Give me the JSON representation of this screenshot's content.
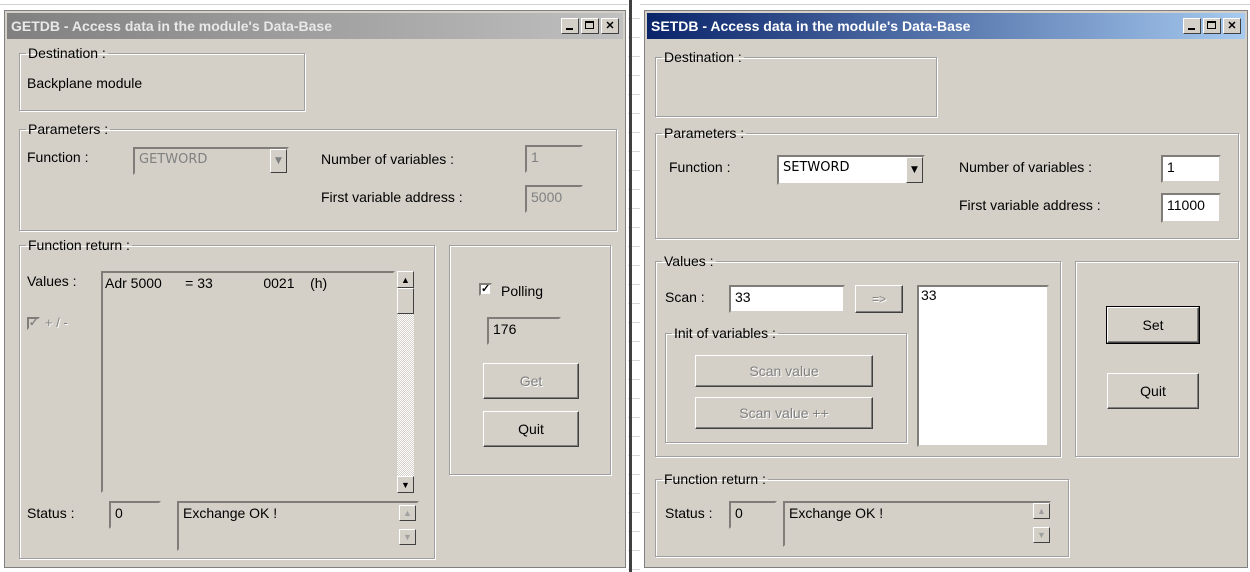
{
  "getdb": {
    "title": "GETDB - Access data in the module's Data-Base",
    "destination": {
      "legend": "Destination :",
      "value": "Backplane module"
    },
    "parameters": {
      "legend": "Parameters :",
      "function_label": "Function :",
      "function_value": "GETWORD",
      "numvars_label": "Number of variables :",
      "numvars_value": "1",
      "firstaddr_label": "First variable address :",
      "firstaddr_value": "5000"
    },
    "function_return": {
      "legend": "Function return :",
      "values_label": "Values :",
      "values_rows": [
        "Adr 5000      = 33             0021    (h)"
      ],
      "sign_label": "+ / -",
      "status_label": "Status :",
      "status_code": "0",
      "status_text": "Exchange OK !"
    },
    "polling": {
      "label": "Polling",
      "checked": true,
      "count": "176"
    },
    "get_button": "Get",
    "quit_button": "Quit"
  },
  "setdb": {
    "title": "SETDB - Access data in the module's Data-Base",
    "destination": {
      "legend": "Destination :",
      "value": ""
    },
    "parameters": {
      "legend": "Parameters :",
      "function_label": "Function :",
      "function_value": "SETWORD",
      "numvars_label": "Number of variables :",
      "numvars_value": "1",
      "firstaddr_label": "First variable address :",
      "firstaddr_value": "11000"
    },
    "values": {
      "legend": "Values :",
      "scan_label": "Scan :",
      "scan_value": "33",
      "arrow_button": "=>",
      "list_items": [
        "33"
      ],
      "init_legend": "Init of variables :",
      "scan_value_button": "Scan value",
      "scan_value_pp_button": "Scan value ++"
    },
    "set_button": "Set",
    "quit_button": "Quit",
    "function_return": {
      "legend": "Function return :",
      "status_label": "Status :",
      "status_code": "0",
      "status_text": "Exchange OK !"
    }
  },
  "titlebar_buttons": {
    "minimize": "_",
    "maximize": "□",
    "close": "X"
  }
}
